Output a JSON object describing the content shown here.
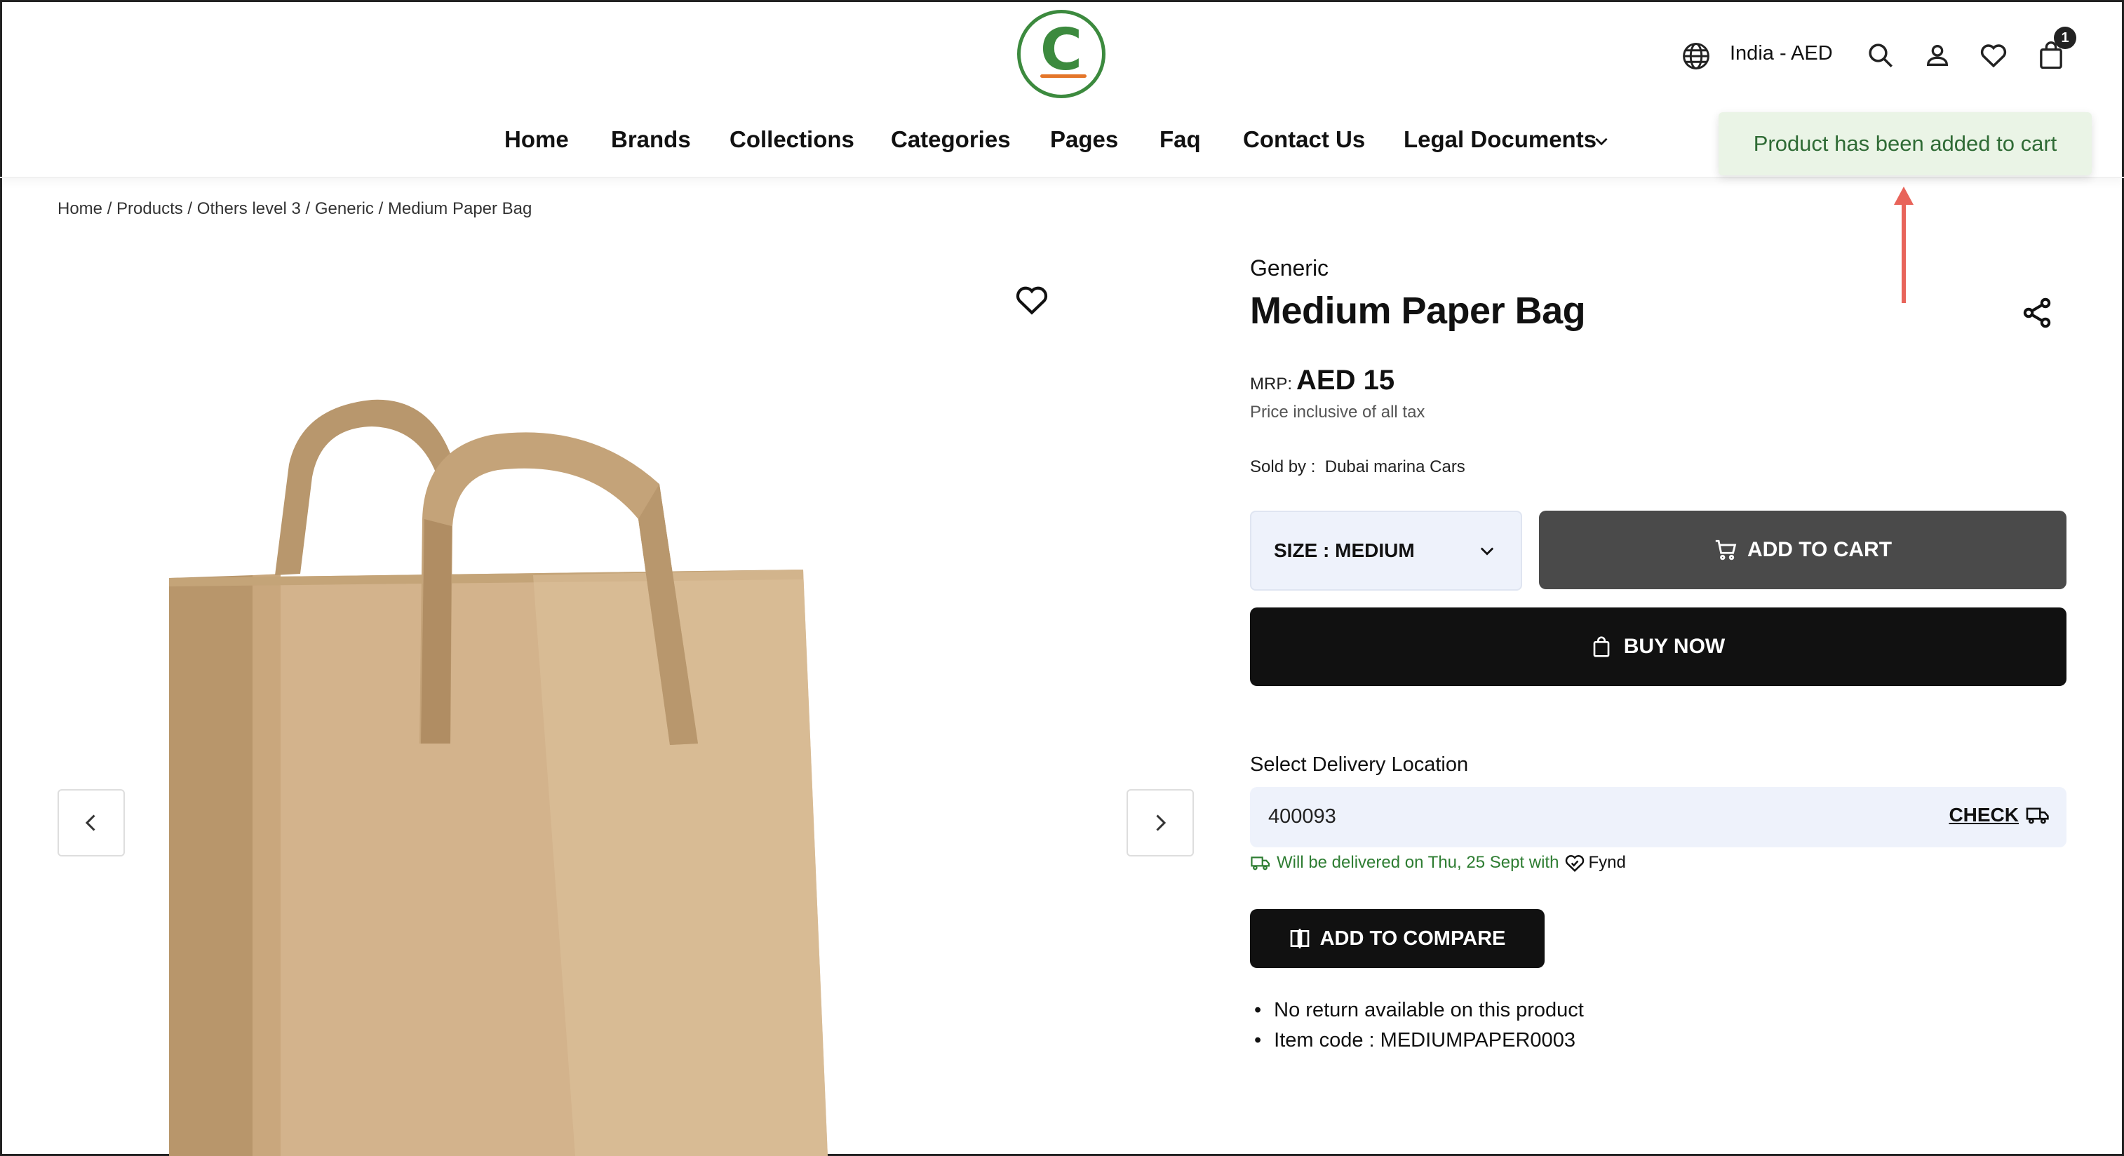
{
  "header": {
    "logo_letter": "C",
    "locale": "India - AED",
    "cart_count": "1",
    "nav": [
      {
        "label": "Home"
      },
      {
        "label": "Brands"
      },
      {
        "label": "Collections"
      },
      {
        "label": "Categories"
      },
      {
        "label": "Pages"
      },
      {
        "label": "Faq"
      },
      {
        "label": "Contact Us"
      },
      {
        "label": "Legal Documents"
      }
    ]
  },
  "toast": {
    "message": "Product has been added to cart"
  },
  "breadcrumb": {
    "items": [
      "Home",
      "Products",
      "Others level 3",
      "Generic",
      "Medium Paper Bag"
    ],
    "separator": " / "
  },
  "product": {
    "brand": "Generic",
    "title": "Medium Paper Bag",
    "mrp_label": "MRP:",
    "price": "AED 15",
    "tax_note": "Price inclusive of all tax",
    "sold_by_label": "Sold by :",
    "seller": "Dubai marina Cars",
    "size_label": "SIZE : MEDIUM",
    "add_to_cart_label": "ADD TO CART",
    "buy_now_label": "BUY NOW",
    "delivery_label": "Select Delivery Location",
    "pincode": "400093",
    "check_label": "CHECK",
    "delivery_message": "Will be delivered on Thu, 25 Sept with",
    "delivery_partner": "Fynd",
    "compare_label": "ADD TO COMPARE",
    "bullets": [
      "No return available on this product",
      "Item code : MEDIUMPAPER0003"
    ]
  },
  "colors": {
    "primary_dark": "#111111",
    "add_to_cart_bg": "#4a4a4a",
    "toast_bg": "#eaf4e6",
    "toast_text": "#2f6b35",
    "logo_green": "#3c8a3e",
    "logo_accent": "#e4762a",
    "delivery_text": "#2e7d32",
    "input_bg": "#eef2fb",
    "annotation_arrow": "#e8645a",
    "bag_kraft": "#d2b48c"
  },
  "icons": [
    "globe-icon",
    "search-icon",
    "user-icon",
    "heart-icon",
    "bag-icon",
    "chevron-down-icon",
    "share-icon",
    "cart-icon",
    "shopping-bag-icon",
    "truck-icon",
    "compare-icon",
    "chevron-left-icon",
    "chevron-right-icon"
  ]
}
